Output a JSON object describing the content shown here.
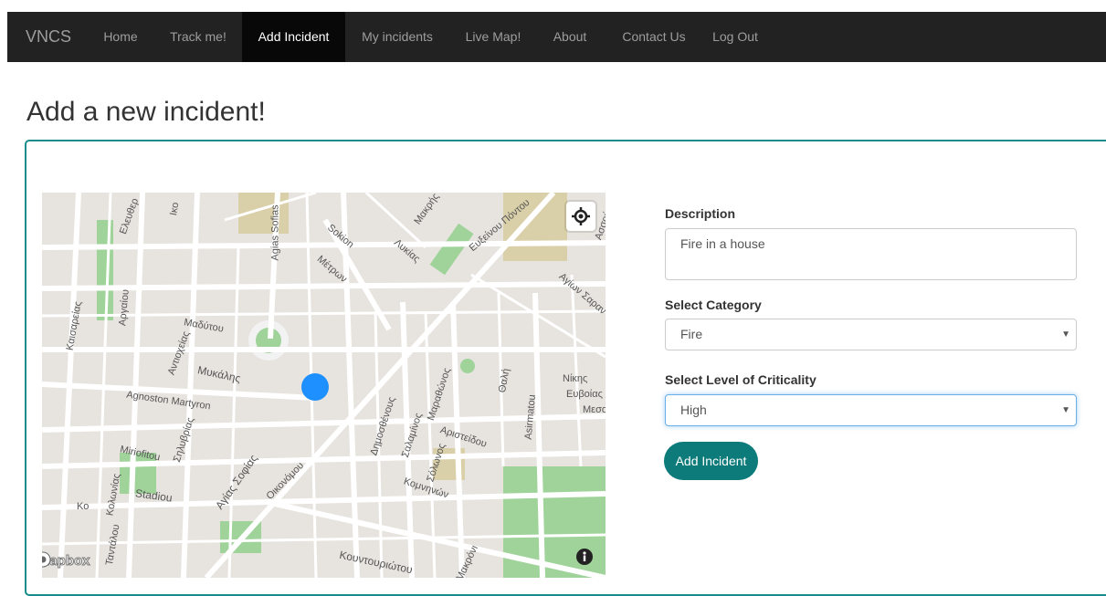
{
  "nav": {
    "brand": "VNCS",
    "items": [
      {
        "label": "Home"
      },
      {
        "label": "Track me!"
      },
      {
        "label": "Add Incident",
        "active": true
      },
      {
        "label": "My incidents"
      },
      {
        "label": "Live Map!"
      },
      {
        "label": "About"
      },
      {
        "label": "Contact Us"
      },
      {
        "label": "Log Out"
      }
    ]
  },
  "page": {
    "title": "Add a new incident!"
  },
  "map": {
    "attribution_logo": "mapbox",
    "labels": [
      "Ελευθερ",
      "Agias Sofias",
      "Sokion",
      "Μέτρων",
      "Λυκίας",
      "Μακρής",
      "Ευξείνου Πόντου",
      "Αγίων Σαραν",
      "Καισαρείας",
      "Αργαίου",
      "Μαδύτου",
      "Αντιοχείας",
      "Μυκάλης",
      "Agnoston Martyron",
      "Σηλυβρίας",
      "Miriofitou",
      "Stadiou",
      "Κολωνίας",
      "Αγίας Σοφίας",
      "Οικονόμου",
      "Δημοσθένους",
      "Σαλαμίνος",
      "Μαραθώνος",
      "Αριστείδου",
      "Σόλωνος",
      "Κομνηνών",
      "Θαλή",
      "Asirmatou",
      "Νίκης",
      "Ευβοίας",
      "Μεσο",
      "Κουντουριώτου",
      "Μακρόνι",
      "Ταντάλου",
      "Κο",
      "Ικο",
      "Ασσού"
    ]
  },
  "form": {
    "description_label": "Description",
    "description_value": "Fire in a house",
    "category_label": "Select Category",
    "category_value": "Fire",
    "criticality_label": "Select Level of Criticality",
    "criticality_value": "High",
    "submit_label": "Add Incident"
  },
  "colors": {
    "accent": "#0e7b7b",
    "navbar": "#222222",
    "panel_border": "#1a8c8c"
  }
}
